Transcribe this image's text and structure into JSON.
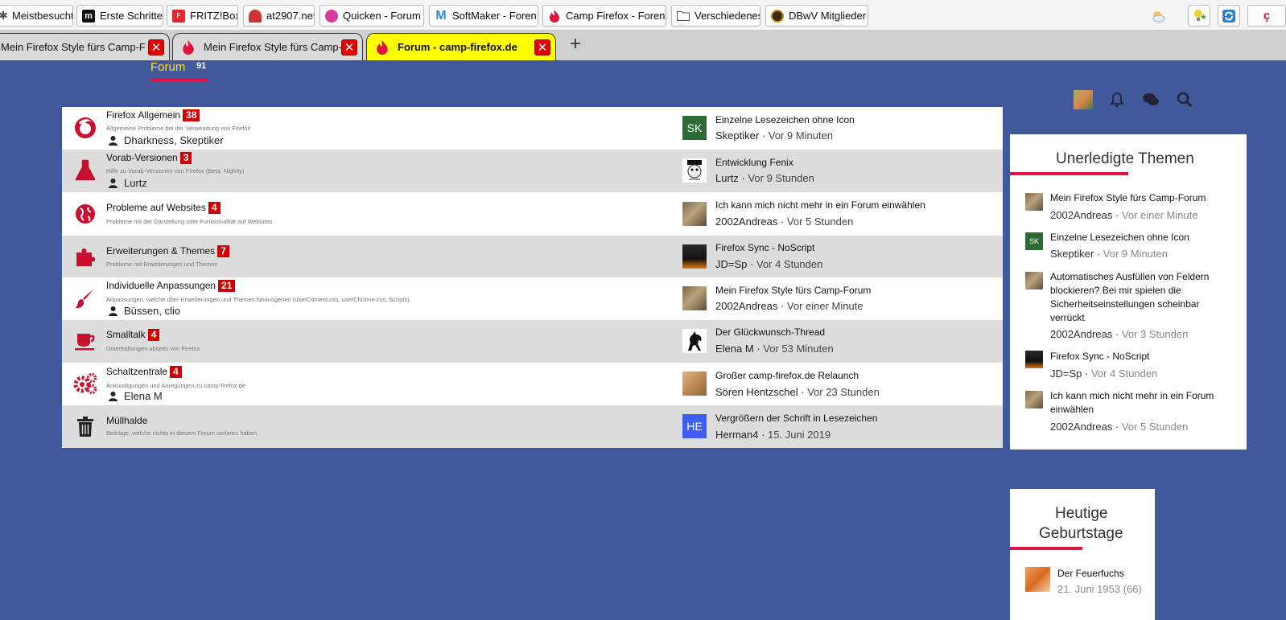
{
  "bookmarks": [
    {
      "label": "Meistbesucht",
      "icon": "star-icon"
    },
    {
      "label": "Erste Schritte",
      "icon": "m-logo-icon"
    },
    {
      "label": "FRITZ!Box",
      "icon": "fritz-icon"
    },
    {
      "label": "at2907.net",
      "icon": "mushroom-icon"
    },
    {
      "label": "Quicken - Forum",
      "icon": "quicken-icon"
    },
    {
      "label": "SoftMaker - Foren",
      "icon": "softmaker-icon"
    },
    {
      "label": "Camp Firefox - Foren",
      "icon": "flame-icon"
    },
    {
      "label": "Verschiedenes",
      "icon": "folder-icon"
    },
    {
      "label": "DBwV Mitglieder",
      "icon": "dbwv-icon"
    }
  ],
  "tabs": [
    {
      "title": "Mein Firefox Style fürs Camp-F",
      "active": false
    },
    {
      "title": "Mein Firefox Style fürs Camp-F",
      "active": false
    },
    {
      "title": "Forum - camp-firefox.de",
      "active": true
    }
  ],
  "nav": {
    "forum_label": "Forum",
    "forum_count": "91"
  },
  "forums": [
    {
      "title": "Firefox Allgemein",
      "badge": "38",
      "desc": "Allgemeine Probleme bei der Verwendung von Firefox",
      "mods": "Dharkness, Skeptiker",
      "icon": "firefox-icon",
      "last_title": "Einzelne Lesezeichen ohne Icon",
      "last_user": "Skeptiker",
      "last_time": "Vor 9 Minuten",
      "avatar": "SK",
      "avatar_color": "#2d6a35"
    },
    {
      "title": "Vorab-Versionen",
      "badge": "3",
      "desc": "Hilfe zu Vorab-Versionen von Firefox (Beta, Nightly)",
      "mods": "Lurtz",
      "icon": "flask-icon",
      "last_title": "Entwicklung Fenix",
      "last_user": "Lurtz",
      "last_time": "Vor 9 Stunden",
      "avatar": "",
      "avatar_color": "#ffffff"
    },
    {
      "title": "Probleme auf Websites",
      "badge": "4",
      "desc": "Probleme mit der Darstellung oder Funktionalität auf Websites",
      "mods": "",
      "icon": "globe-icon",
      "last_title": "Ich kann mich nicht mehr in ein Forum einwählen",
      "last_user": "2002Andreas",
      "last_time": "Vor 5 Stunden",
      "avatar": "",
      "avatar_color": "#8a7655"
    },
    {
      "title": "Erweiterungen & Themes",
      "badge": "7",
      "desc": "Probleme mit Erweiterungen und Themes",
      "mods": "",
      "icon": "puzzle-icon",
      "last_title": "Firefox Sync - NoScript",
      "last_user": "JD=Sp",
      "last_time": "Vor 4 Stunden",
      "avatar": "",
      "avatar_color": "#203040"
    },
    {
      "title": "Individuelle Anpassungen",
      "badge": "21",
      "desc": "Anpassungen, welche über Erweiterungen und Themes hinausgehen (userContent.css, userChrome.css, Scripts)",
      "mods": "Büssen, clio",
      "icon": "brush-icon",
      "last_title": "Mein Firefox Style fürs Camp-Forum",
      "last_user": "2002Andreas",
      "last_time": "Vor einer Minute",
      "avatar": "",
      "avatar_color": "#8a7655"
    },
    {
      "title": "Smalltalk",
      "badge": "4",
      "desc": "Unterhaltungen abseits von Firefox",
      "mods": "",
      "icon": "coffee-icon",
      "last_title": "Der Glückwunsch-Thread",
      "last_user": "Elena M",
      "last_time": "Vor 53 Minuten",
      "avatar": "",
      "avatar_color": "#ffffff"
    },
    {
      "title": "Schaltzentrale",
      "badge": "4",
      "desc": "Ankündigungen und Anregungen zu camp-firefox.de",
      "mods": "Elena M",
      "icon": "gears-icon",
      "last_title": "Großer camp-firefox.de Relaunch",
      "last_user": "Sören Hentzschel",
      "last_time": "Vor 23 Stunden",
      "avatar": "",
      "avatar_color": "#c9a57c"
    },
    {
      "title": "Müllhalde",
      "badge": "",
      "desc": "Beiträge, welche nichts in diesem Forum verloren haben",
      "mods": "",
      "icon": "trash-icon",
      "last_title": "Vergrößern der Schrift in Lesezeichen",
      "last_user": "Herman4",
      "last_time": "15. Juni 2019",
      "avatar": "HE",
      "avatar_color": "#3d5ef0"
    }
  ],
  "sidebar": {
    "unresolved_title": "Unerledigte Themen",
    "unresolved": [
      {
        "title": "Mein Firefox Style fürs Camp-Forum",
        "user": "2002Andreas",
        "time": "Vor einer Minute",
        "avatar": ""
      },
      {
        "title": "Einzelne Lesezeichen ohne Icon",
        "user": "Skeptiker",
        "time": "Vor 9 Minuten",
        "avatar": "SK"
      },
      {
        "title": "Automatisches Ausfüllen von Feldern blockieren? Bei mir spielen die Sicherheitseinstellungen scheinbar verrückt",
        "user": "2002Andreas",
        "time": "Vor 3 Stunden",
        "avatar": ""
      },
      {
        "title": "Firefox Sync - NoScript",
        "user": "JD=Sp",
        "time": "Vor 4 Stunden",
        "avatar": ""
      },
      {
        "title": "Ich kann mich nicht mehr in ein Forum einwählen",
        "user": "2002Andreas",
        "time": "Vor 5 Stunden",
        "avatar": ""
      }
    ],
    "birthday_title_1": "Heutige",
    "birthday_title_2": "Geburtstage",
    "birthday_name": "Der Feuerfuchs",
    "birthday_date": "21. Juni 1953 (66)"
  },
  "colors": {
    "background": "#41589b",
    "accent": "#e0123f",
    "badge": "#d40000",
    "nav_active": "#ffdd33",
    "active_tab": "#ffff00"
  }
}
